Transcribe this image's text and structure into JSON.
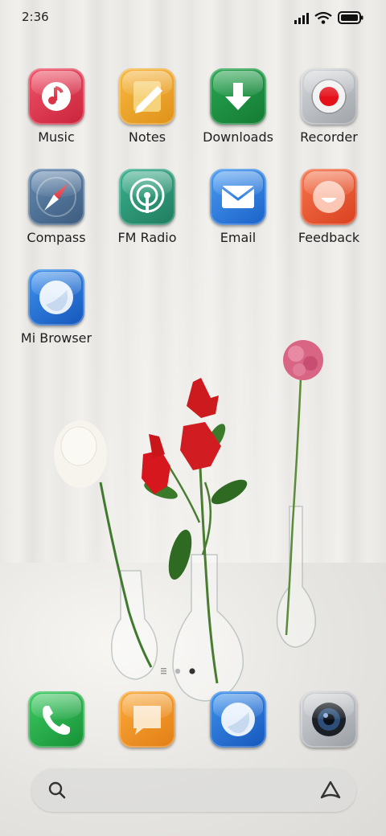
{
  "status_bar": {
    "time": "2:36",
    "icons": [
      "signal-icon",
      "wifi-icon",
      "battery-icon"
    ]
  },
  "apps": [
    {
      "label": "Music",
      "icon": "music-icon",
      "color": "#e03a4a"
    },
    {
      "label": "Notes",
      "icon": "notes-icon",
      "color": "#f0a326"
    },
    {
      "label": "Downloads",
      "icon": "downloads-icon",
      "color": "#1f8a3e"
    },
    {
      "label": "Recorder",
      "icon": "recorder-icon",
      "color": "#b9bcc0"
    },
    {
      "label": "Compass",
      "icon": "compass-icon",
      "color": "#4d6f92"
    },
    {
      "label": "FM Radio",
      "icon": "radio-icon",
      "color": "#2c9a77"
    },
    {
      "label": "Email",
      "icon": "email-icon",
      "color": "#2f7fe0"
    },
    {
      "label": "Feedback",
      "icon": "feedback-icon",
      "color": "#ef5a36"
    },
    {
      "label": "Mi Browser",
      "icon": "browser-icon",
      "color": "#2778d8"
    }
  ],
  "page_indicator": {
    "pages": 2,
    "current": 2
  },
  "dock": [
    {
      "icon": "phone-icon",
      "color": "#27b04b"
    },
    {
      "icon": "messages-icon",
      "color": "#f39a27"
    },
    {
      "icon": "browser-icon",
      "color": "#2778d8"
    },
    {
      "icon": "camera-icon",
      "color": "#b9bcc0"
    }
  ],
  "search_bar": {
    "left_icon": "search-icon",
    "right_icon": "assistant-icon"
  },
  "wallpaper": "white-cloth-with-flowers-in-glass-vases"
}
